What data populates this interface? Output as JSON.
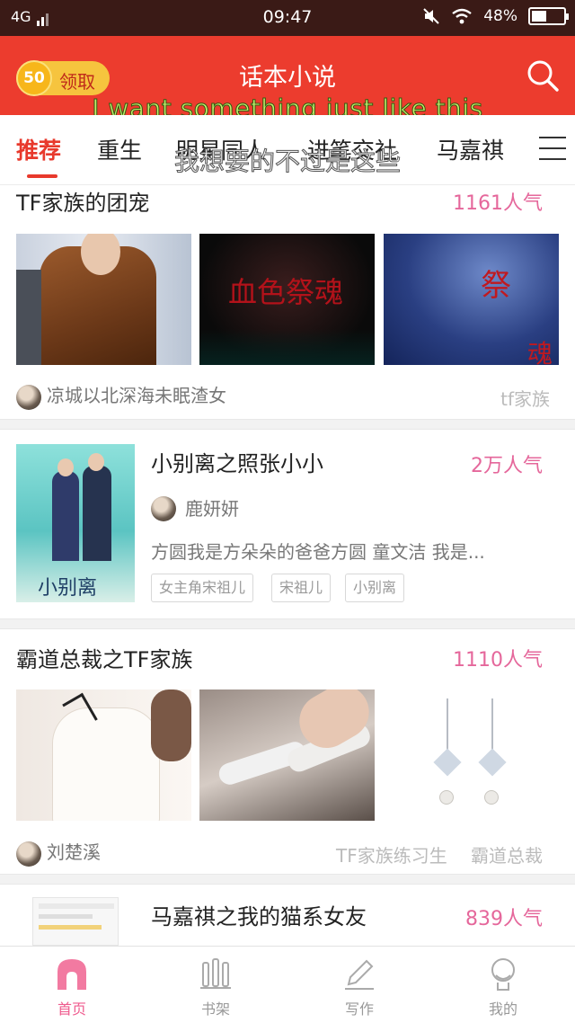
{
  "status_bar": {
    "network": "4G",
    "time": "09:47",
    "battery": "48%",
    "battery_level": 0.48
  },
  "header": {
    "coin_amount": "50",
    "claim_label": "领取",
    "title": "话本小说"
  },
  "overlay": {
    "english": "I want something just like this",
    "chinese": "我想要的不过是这些"
  },
  "tabs": [
    {
      "label": "推荐",
      "active": true
    },
    {
      "label": "重生"
    },
    {
      "label": "明星同人"
    },
    {
      "label": "进笔交社"
    },
    {
      "label": "马嘉祺"
    }
  ],
  "feed": [
    {
      "title": "TF家族的团宠",
      "popularity": "1161人气",
      "author": "凉城以北深海未眠渣女",
      "tags": [
        "tf家族"
      ]
    },
    {
      "title": "小别离之照张小小",
      "popularity": "2万人气",
      "author": "鹿妍妍",
      "description": "方圆我是方朵朵的爸爸方圆 童文洁 我是...",
      "cover_text": "小别离",
      "tags": [
        "女主角宋祖儿",
        "宋祖儿",
        "小别离"
      ]
    },
    {
      "title": "霸道总裁之TF家族",
      "popularity": "1110人气",
      "author": "刘楚溪",
      "tags": [
        "TF家族练习生",
        "霸道总裁"
      ]
    },
    {
      "title": "马嘉祺之我的猫系女友",
      "popularity": "839人气"
    }
  ],
  "image_text": {
    "blood_title": "血色祭魂",
    "ji": "祭",
    "hun": "魂"
  },
  "bottom_nav": [
    {
      "label": "首页",
      "icon": "home-icon",
      "active": true
    },
    {
      "label": "书架",
      "icon": "bookshelf-icon"
    },
    {
      "label": "写作",
      "icon": "pen-icon"
    },
    {
      "label": "我的",
      "icon": "profile-icon"
    }
  ],
  "colors": {
    "brand_red": "#ec3c2e",
    "popularity_pink": "#e5679b",
    "coin_gold": "#f7b61a"
  }
}
